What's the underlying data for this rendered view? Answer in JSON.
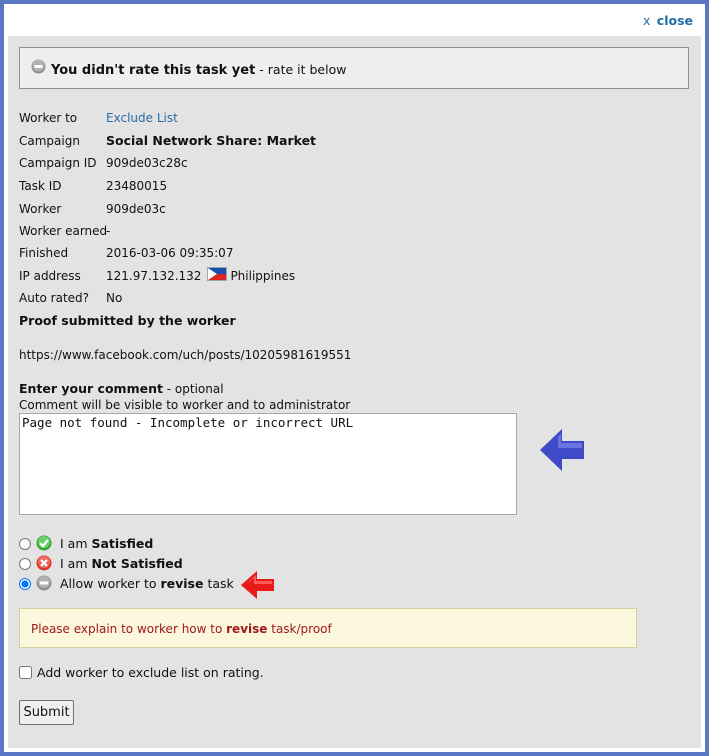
{
  "dialog": {
    "close_x": "x",
    "close_label": "close"
  },
  "notice": {
    "bold": "You didn't rate this task yet",
    "rest": " - rate it below"
  },
  "info": {
    "worker_to": {
      "label": "Worker to",
      "value": "Exclude List"
    },
    "campaign": {
      "label": "Campaign",
      "value": "Social Network Share: Market"
    },
    "campaign_id": {
      "label": "Campaign ID",
      "value": "909de03c28c"
    },
    "task_id": {
      "label": "Task ID",
      "value": "23480015"
    },
    "worker": {
      "label": "Worker",
      "value": "909de03c"
    },
    "worker_earned": {
      "label": "Worker earned",
      "value": "-"
    },
    "finished": {
      "label": "Finished",
      "value": "2016-03-06 09:35:07"
    },
    "ip_address": {
      "label": "IP address",
      "value": "121.97.132.132",
      "country": "Philippines"
    },
    "auto_rated": {
      "label": "Auto rated?",
      "value": "No"
    }
  },
  "proof": {
    "heading": "Proof submitted by the worker",
    "url": "https://www.facebook.com/uch/posts/10205981619551"
  },
  "comment": {
    "heading_bold": "Enter your comment",
    "heading_rest": " - optional",
    "note": "Comment will be visible to worker and to administrator",
    "value": "Page not found - Incomplete or incorrect URL"
  },
  "options": {
    "satisfied": {
      "prefix": "I am ",
      "bold": "Satisfied",
      "suffix": "",
      "selected": false
    },
    "not_satisfied": {
      "prefix": "I am ",
      "bold": "Not Satisfied",
      "suffix": "",
      "selected": false
    },
    "revise": {
      "prefix": "Allow worker to ",
      "bold": "revise",
      "suffix": " task",
      "selected": true
    }
  },
  "hint": {
    "prefix": "Please explain to worker how to ",
    "bold": "revise",
    "suffix": " task/proof"
  },
  "exclude": {
    "label": "Add worker to exclude list on rating.",
    "checked": false
  },
  "submit_label": "Submit",
  "colors": {
    "frame": "#5877c4",
    "panel": "#e3e3e3",
    "link": "#2a6aa8",
    "hint_bg": "#fbf8dd",
    "hint_text": "#a11818",
    "arrow_blue": "#4049c8",
    "arrow_red": "#e81a1a"
  },
  "icons": {
    "notice": "minus-circle-icon",
    "satisfied": "check-circle-icon",
    "not_satisfied": "x-circle-icon",
    "revise": "minus-circle-icon"
  }
}
